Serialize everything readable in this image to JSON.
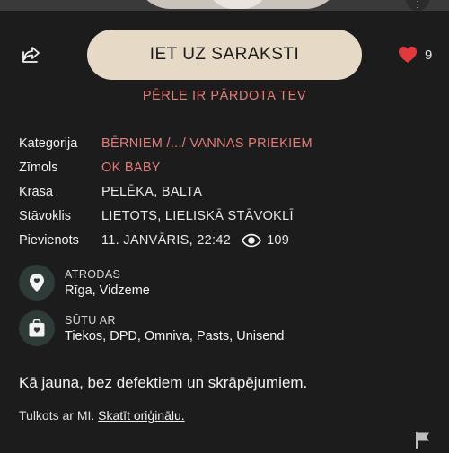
{
  "header": {
    "main_button_label": "IET UZ SARAKSTI",
    "like_count": "9",
    "sold_note": "PĒRLE IR PĀRDOTA TEV"
  },
  "details": [
    {
      "key": "Kategorija",
      "value": "BĒRNIEM /.../ VANNAS PRIEKIEM",
      "link": true
    },
    {
      "key": "Zīmols",
      "value": "OK BABY",
      "link": true
    },
    {
      "key": "Krāsa",
      "value": "PELĒKA, BALTA",
      "link": false
    },
    {
      "key": "Stāvoklis",
      "value": "LIETOTS, LIELISKĀ STĀVOKLĪ",
      "link": false
    },
    {
      "key": "Pievienots",
      "value": "11. JANVĀRIS, 22:42",
      "link": false
    }
  ],
  "views": "109",
  "location": {
    "label": "ATRODAS",
    "value": "Rīga, Vidzeme"
  },
  "shipping": {
    "label": "SŪTU AR",
    "value": "Tiekos, DPD, Omniva, Pasts, Unisend"
  },
  "description": "Kā jauna, bez defektiem un skrāpējumiem.",
  "translation": {
    "prefix": "Tulkots ar MI.",
    "link": "Skatīt oriģinālu."
  },
  "colors": {
    "accent": "#e27d7a",
    "button_bg": "#e6d9c6",
    "background": "#1c1c1c",
    "icon_circle": "#2f3b38",
    "heart": "#e0393e"
  },
  "icons": [
    "share-icon",
    "heart-icon",
    "eye-icon",
    "location-pin-icon",
    "bag-icon",
    "flag-icon",
    "more-icon"
  ]
}
